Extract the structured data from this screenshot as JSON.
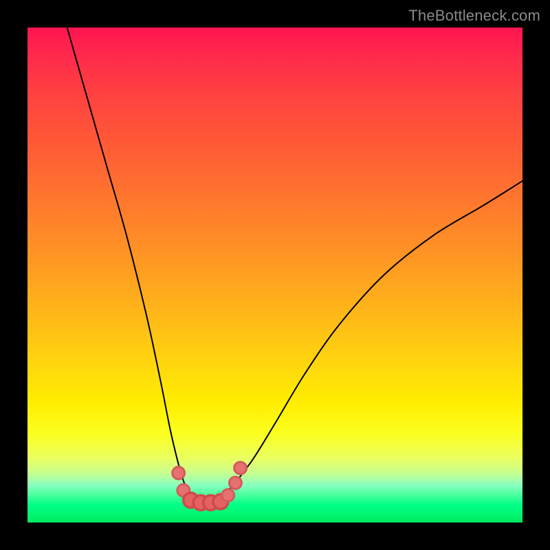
{
  "watermark": "TheBottleneck.com",
  "chart_data": {
    "type": "line",
    "title": "",
    "xlabel": "",
    "ylabel": "",
    "xlim": [
      0,
      100
    ],
    "ylim": [
      0,
      100
    ],
    "grid": false,
    "curve": {
      "x": [
        8,
        12,
        16,
        20,
        24,
        27,
        29,
        31,
        32.5,
        34,
        36,
        40,
        45,
        50,
        56,
        63,
        72,
        82,
        92,
        100
      ],
      "y": [
        100,
        86,
        72,
        58,
        42,
        28,
        18,
        10,
        6,
        4,
        4,
        6,
        12,
        20,
        30,
        40,
        50,
        58,
        64,
        69
      ]
    },
    "points": {
      "x": [
        30.5,
        31.5,
        33,
        35,
        37,
        39,
        40.5,
        42,
        43
      ],
      "y": [
        10,
        6.5,
        4.5,
        4,
        4,
        4.2,
        5.5,
        8,
        11
      ]
    }
  },
  "colors": {
    "background": "#000000",
    "curve": "#000000",
    "points": "#e87070",
    "watermark": "#888a8c"
  }
}
